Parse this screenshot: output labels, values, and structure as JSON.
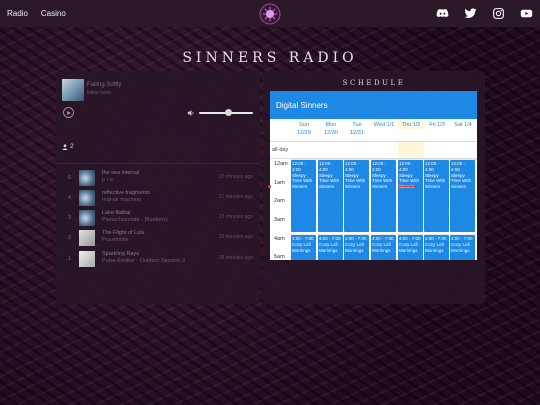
{
  "nav": {
    "links": [
      "Radio",
      "Casino"
    ]
  },
  "socials": [
    "discord-icon",
    "twitter-icon",
    "instagram-icon",
    "youtube-icon"
  ],
  "page_title": "SINNERS RADIO",
  "now_playing": {
    "title": "Falling Softly",
    "artist": "kaleo kane",
    "listeners": "2"
  },
  "history": [
    {
      "num": "6",
      "title": "the sea interval",
      "artist": "p r e",
      "time": "20 minutes ago"
    },
    {
      "num": "4",
      "title": "reflective fragments",
      "artist": "mid-air machine",
      "time": "21 minutes ago"
    },
    {
      "num": "3",
      "title": "Lake Baikal",
      "artist": "Pianochocolate - Blueberry",
      "time": "23 minutes ago"
    },
    {
      "num": "2",
      "title": "The Flight of Lulu",
      "artist": "Possimiste",
      "time": "26 minutes ago"
    },
    {
      "num": "1",
      "title": "Sparkling Rays",
      "artist": "Pulse Emitter - Outdoor Session 2",
      "time": "28 minutes ago"
    }
  ],
  "schedule": {
    "heading": "SCHEDULE",
    "calendar_title": "Digital Sinners",
    "days": [
      {
        "dow": "Sun",
        "date": "12/29"
      },
      {
        "dow": "Mon",
        "date": "12/30"
      },
      {
        "dow": "Tue",
        "date": "12/31"
      },
      {
        "dow": "Wed 1/1",
        "date": ""
      },
      {
        "dow": "Thu 1/2",
        "date": ""
      },
      {
        "dow": "Fri 1/3",
        "date": ""
      },
      {
        "dow": "Sat 1/4",
        "date": ""
      }
    ],
    "allday_label": "all-day",
    "times": [
      "12am",
      "1am",
      "2am",
      "3am",
      "4am",
      "5am"
    ],
    "event1": {
      "time": "12:00 - 4:00",
      "title": "Sleepy Time With Sinners"
    },
    "event2": {
      "time": "4:00 - 7:00",
      "title": "Cozy Lofi Mornings"
    }
  },
  "colors": {
    "accent": "#1e88e5",
    "today": "#fdf6d8",
    "now": "#e53935"
  }
}
